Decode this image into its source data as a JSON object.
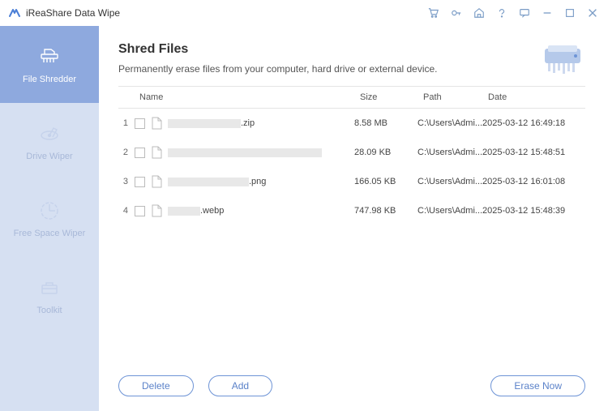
{
  "app_title": "iReaShare Data Wipe",
  "sidebar": {
    "items": [
      {
        "label": "File Shredder",
        "icon": "shredder"
      },
      {
        "label": "Drive Wiper",
        "icon": "drive"
      },
      {
        "label": "Free Space Wiper",
        "icon": "freespace"
      },
      {
        "label": "Toolkit",
        "icon": "toolkit"
      }
    ]
  },
  "page": {
    "title": "Shred Files",
    "subtitle": "Permanently erase files from your computer, hard drive or external device."
  },
  "table": {
    "headers": {
      "name": "Name",
      "size": "Size",
      "path": "Path",
      "date": "Date"
    },
    "rows": [
      {
        "num": "1",
        "ext": ".zip",
        "size": "8.58 MB",
        "path": "C:\\Users\\Admi...",
        "date": "2025-03-12 16:49:18",
        "rw": 90
      },
      {
        "num": "2",
        "ext": "",
        "size": "28.09 KB",
        "path": "C:\\Users\\Admi...",
        "date": "2025-03-12 15:48:51",
        "rw": 190
      },
      {
        "num": "3",
        "ext": ".png",
        "size": "166.05 KB",
        "path": "C:\\Users\\Admi...",
        "date": "2025-03-12 16:01:08",
        "rw": 100
      },
      {
        "num": "4",
        "ext": ".webp",
        "size": "747.98 KB",
        "path": "C:\\Users\\Admi...",
        "date": "2025-03-12 15:48:39",
        "rw": 40
      }
    ]
  },
  "buttons": {
    "delete": "Delete",
    "add": "Add",
    "erase": "Erase Now"
  }
}
